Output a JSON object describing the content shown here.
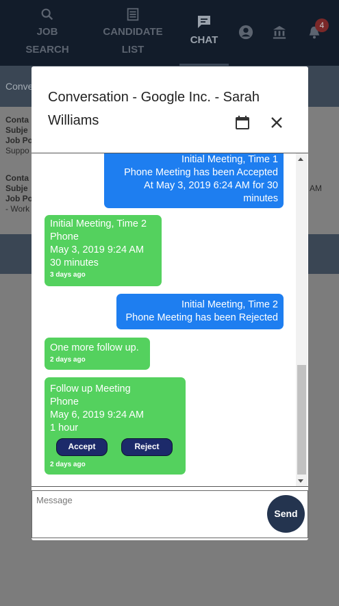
{
  "nav": {
    "items": [
      {
        "line1": "JOB",
        "line2": "SEARCH",
        "icon": "search-icon"
      },
      {
        "line1": "CANDIDATE",
        "line2": "LIST",
        "icon": "list-icon"
      },
      {
        "label": "CHAT",
        "icon": "chat-icon"
      }
    ],
    "notifications": "4"
  },
  "background": {
    "header": "Conve",
    "block1": [
      "Conta",
      "Subje",
      "Job Po",
      "Suppo"
    ],
    "block2": [
      "Conta",
      "Subje",
      "Job Po",
      "- Work"
    ],
    "right_fragment": "AM"
  },
  "modal": {
    "title": "Conversation - Google Inc. - Sarah Williams",
    "messages": [
      {
        "dir": "out",
        "lines": [
          "Initial Meeting, Time 1",
          "Phone Meeting has been Accepted",
          "At May 3, 2019 6:24 AM for 30",
          "minutes"
        ]
      },
      {
        "dir": "in",
        "lines": [
          "Initial Meeting, Time 2",
          "Phone",
          "May 3, 2019 9:24 AM",
          "30 minutes"
        ],
        "time": "3 days ago"
      },
      {
        "dir": "out",
        "lines": [
          "Initial Meeting, Time 2",
          "Phone Meeting has been Rejected"
        ]
      },
      {
        "dir": "in",
        "lines": [
          "One more follow up."
        ],
        "time": "2 days ago"
      },
      {
        "dir": "in",
        "lines": [
          "Follow up Meeting",
          "Phone",
          "May 6, 2019 9:24 AM",
          "1 hour"
        ],
        "time": "2 days ago",
        "accept_label": "Accept",
        "reject_label": "Reject"
      }
    ],
    "input_placeholder": "Message",
    "send_label": "Send"
  }
}
